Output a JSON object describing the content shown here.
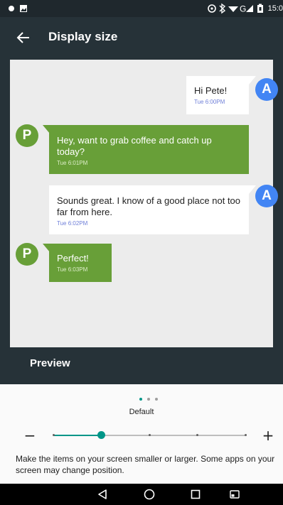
{
  "status_bar": {
    "time": "15:0",
    "icons": [
      "notification-dot-icon",
      "image-notification-icon",
      "data-saver-icon",
      "bluetooth-icon",
      "wifi-icon",
      "signal-icon",
      "battery-icon"
    ]
  },
  "app_bar": {
    "title": "Display size",
    "back_icon": "arrow-left-icon"
  },
  "preview": {
    "messages": [
      {
        "type": "sent",
        "avatar": "A",
        "text": "Hi Pete!",
        "time": "Tue 6:00PM"
      },
      {
        "type": "received",
        "avatar": "P",
        "text": "Hey, want to grab coffee and catch up today?",
        "time": "Tue 6:01PM"
      },
      {
        "type": "sent",
        "avatar": "A",
        "text": "Sounds great. I know of a good place not too far from here.",
        "time": "Tue 6:02PM"
      },
      {
        "type": "received",
        "avatar": "P",
        "text": "Perfect!",
        "time": "Tue 6:03PM"
      }
    ],
    "label": "Preview"
  },
  "controls": {
    "page_indicator": {
      "count": 3,
      "active": 0
    },
    "size_label": "Default",
    "minus_label": "−",
    "plus_label": "+",
    "slider": {
      "steps": 5,
      "value_index": 1
    },
    "description": "Make the items on your screen smaller or larger. Some apps on your screen may change position."
  },
  "nav_bar": {
    "icons": [
      "back-triangle-icon",
      "home-circle-icon",
      "recents-square-icon",
      "cast-icon"
    ]
  },
  "colors": {
    "accent": "#009688",
    "app_bar": "#263238",
    "avatar_a": "#4285f4",
    "avatar_p": "#689f38",
    "received_bubble": "#689f38"
  }
}
